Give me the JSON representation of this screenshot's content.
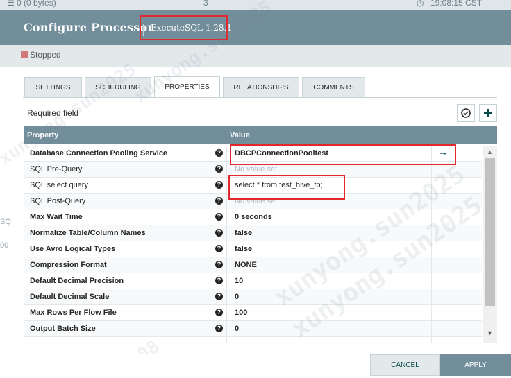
{
  "top_strip": {
    "text": "0 (0 bytes)",
    "count": "3",
    "time": "19:08:15 CST"
  },
  "header": {
    "title": "Configure Processor",
    "subtitle": "ExecuteSQL 1.28.1"
  },
  "status": {
    "label": "Stopped",
    "color": "#d17a7a"
  },
  "tabs": [
    {
      "label": "SETTINGS"
    },
    {
      "label": "SCHEDULING"
    },
    {
      "label": "PROPERTIES",
      "active": true
    },
    {
      "label": "RELATIONSHIPS"
    },
    {
      "label": "COMMENTS"
    }
  ],
  "properties": {
    "required_label": "Required field",
    "header": {
      "property": "Property",
      "value": "Value"
    },
    "rows": [
      {
        "name": "Database Connection Pooling Service",
        "value": "DBCPConnectionPooltest",
        "required": true
      },
      {
        "name": "SQL Pre-Query",
        "value": "No value set",
        "required": false
      },
      {
        "name": "SQL select query",
        "value": "select * from test_hive_tb;",
        "required": false
      },
      {
        "name": "SQL Post-Query",
        "value": "No value set",
        "required": false
      },
      {
        "name": "Max Wait Time",
        "value": "0 seconds",
        "required": true
      },
      {
        "name": "Normalize Table/Column Names",
        "value": "false",
        "required": true
      },
      {
        "name": "Use Avro Logical Types",
        "value": "false",
        "required": true
      },
      {
        "name": "Compression Format",
        "value": "NONE",
        "required": true
      },
      {
        "name": "Default Decimal Precision",
        "value": "10",
        "required": true
      },
      {
        "name": "Default Decimal Scale",
        "value": "0",
        "required": true
      },
      {
        "name": "Max Rows Per Flow File",
        "value": "100",
        "required": true
      },
      {
        "name": "Output Batch Size",
        "value": "0",
        "required": true
      }
    ]
  },
  "footer": {
    "cancel": "CANCEL",
    "apply": "APPLY"
  },
  "left_edge": {
    "a": "SQ",
    "b": "00"
  },
  "watermark": {
    "a": "xunyong.sun2025",
    "b": "xunyong.sun2025",
    "c": "xunyong.sun2025",
    "d": "xunyong.sun2025",
    "e": "9:08"
  },
  "colors": {
    "accent": "#728e9b",
    "highlight": "#e0282e",
    "status": "#d17a7a"
  }
}
